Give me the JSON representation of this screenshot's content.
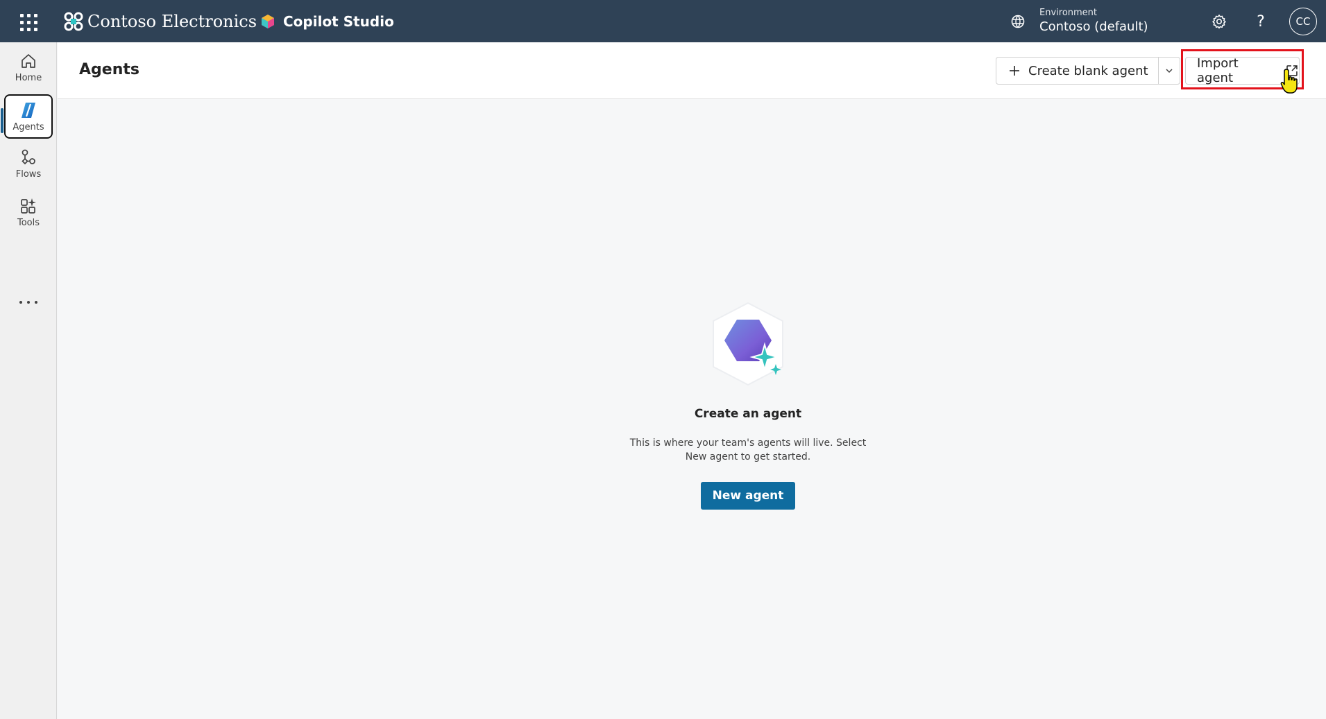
{
  "topbar": {
    "org_name": "Contoso Electronics",
    "product_name": "Copilot Studio",
    "environment_label": "Environment",
    "environment_value": "Contoso (default)",
    "help_glyph": "?",
    "avatar_initials": "CC",
    "icons": [
      "waffle-icon",
      "contoso-logo-icon",
      "copilot-studio-logo-icon",
      "environment-icon",
      "gear-icon",
      "help-icon"
    ]
  },
  "rail": {
    "items": [
      {
        "label": "Home",
        "icon": "home-icon"
      },
      {
        "label": "Agents",
        "icon": "agents-icon",
        "active": true
      },
      {
        "label": "Flows",
        "icon": "flows-icon"
      },
      {
        "label": "Tools",
        "icon": "tools-icon"
      }
    ],
    "more_icon": "more-icon"
  },
  "header": {
    "title": "Agents",
    "create_label": "Create blank agent",
    "import_label": "Import agent"
  },
  "empty_state": {
    "title": "Create an agent",
    "description": "This is where your team's agents will live. Select New agent to get started.",
    "button_label": "New agent"
  },
  "colors": {
    "topbar": "#2f4256",
    "primary_button": "#0f6c9f",
    "highlight": "#e3121b",
    "active_indicator": "#1a5f8f"
  }
}
